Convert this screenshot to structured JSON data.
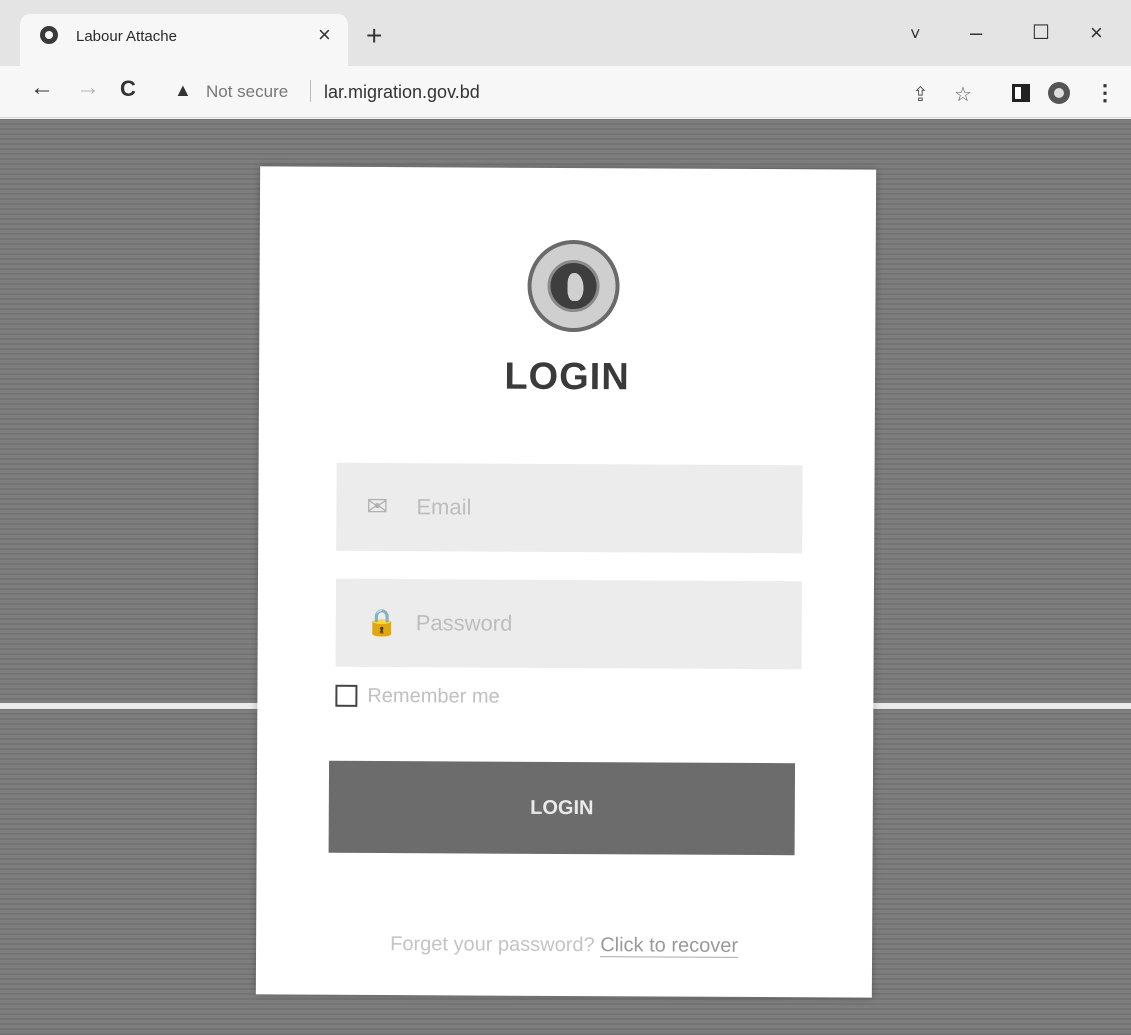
{
  "browser": {
    "tab_title": "Labour Attache",
    "tab_close": "×",
    "new_tab": "+",
    "security_warning": "Not secure",
    "url": "lar.migration.gov.bd",
    "window_controls": {
      "dropdown": "˅",
      "minimize": "–",
      "maximize": "☐",
      "close": "×"
    },
    "nav": {
      "back": "←",
      "forward": "→",
      "reload": "C"
    },
    "toolbar_icons": {
      "share": "⇪",
      "bookmark": "☆",
      "menu": "⋮"
    },
    "icons": [
      "chrome-favicon",
      "warning-icon",
      "share-icon",
      "star-icon",
      "side-panel-icon",
      "profile-icon",
      "menu-icon"
    ]
  },
  "login": {
    "title": "LOGIN",
    "email_placeholder": "Email",
    "password_placeholder": "Password",
    "remember_label": "Remember me",
    "submit_label": "LOGIN",
    "forgot_text": "Forget your password?",
    "recover_link": "Click to recover",
    "icons": [
      "government-seal",
      "mail-icon",
      "lock-icon"
    ]
  }
}
